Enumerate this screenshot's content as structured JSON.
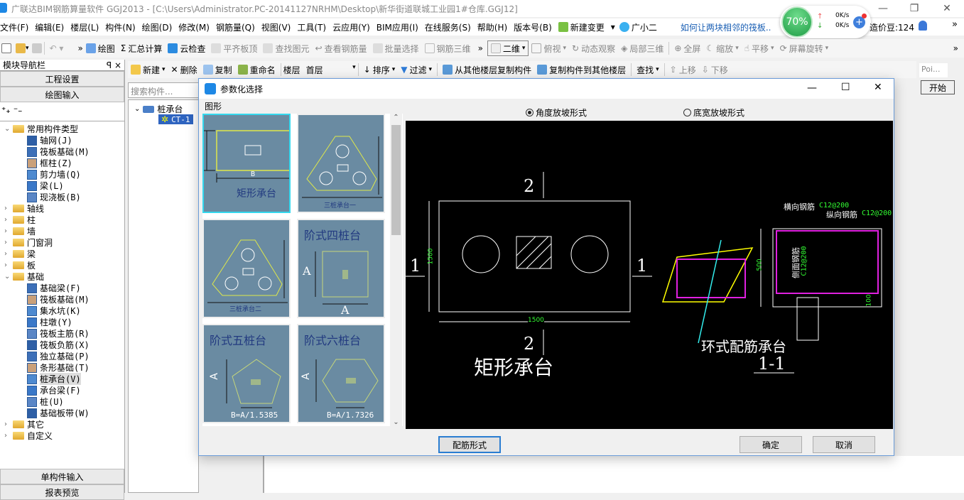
{
  "window": {
    "title": "广联达BIM钢筋算量软件 GGJ2013 - [C:\\Users\\Administrator.PC-20141127NRHM\\Desktop\\新华街道联城工业园1#仓库.GGJ12]",
    "minimize_icon": "minimize-icon",
    "maximize_icon": "restore-icon",
    "close_icon": "close-icon"
  },
  "menubar": {
    "items": [
      "文件(F)",
      "编辑(E)",
      "楼层(L)",
      "构件(N)",
      "绘图(D)",
      "修改(M)",
      "钢筋量(Q)",
      "视图(V)",
      "工具(T)",
      "云应用(Y)",
      "BIM应用(I)",
      "在线服务(S)",
      "帮助(H)",
      "版本号(B)",
      "新建变更",
      "广小二"
    ],
    "news": "如何让两块相邻的筏板..",
    "beans": "造价豆:124",
    "widget": {
      "percent": "70%",
      "up": "0K/s",
      "down": "0K/s"
    }
  },
  "toolbar1": {
    "items": [
      "绘图",
      "汇总计算",
      "云检查",
      "平齐板顶",
      "查找图元",
      "查看钢筋量",
      "批量选择",
      "钢筋三维",
      "二维",
      "俯视",
      "动态观察",
      "局部三维",
      "全屏",
      "缩放",
      "平移",
      "屏幕旋转"
    ]
  },
  "toolbar2": {
    "items": [
      "新建",
      "删除",
      "复制",
      "重命名",
      "楼层",
      "首层",
      "排序",
      "过滤",
      "从其他楼层复制构件",
      "复制构件到其他楼层",
      "查找",
      "上移",
      "下移"
    ]
  },
  "right_panel": {
    "poi": "Poi...",
    "start": "开始"
  },
  "nav": {
    "title": "模块导航栏",
    "pin": "ꟼ",
    "close": "×",
    "btn_settings": "工程设置",
    "btn_draw": "绘图输入",
    "btn_single": "单构件输入",
    "btn_report": "报表预览",
    "tree": [
      {
        "label": "常用构件类型",
        "level": 0,
        "type": "folder-open"
      },
      {
        "label": "轴网(J)",
        "level": 1
      },
      {
        "label": "筏板基础(M)",
        "level": 1
      },
      {
        "label": "框柱(Z)",
        "level": 1
      },
      {
        "label": "剪力墙(Q)",
        "level": 1
      },
      {
        "label": "梁(L)",
        "level": 1
      },
      {
        "label": "现浇板(B)",
        "level": 1
      },
      {
        "label": "轴线",
        "level": 0,
        "type": "folder"
      },
      {
        "label": "柱",
        "level": 0,
        "type": "folder"
      },
      {
        "label": "墙",
        "level": 0,
        "type": "folder"
      },
      {
        "label": "门窗洞",
        "level": 0,
        "type": "folder"
      },
      {
        "label": "梁",
        "level": 0,
        "type": "folder"
      },
      {
        "label": "板",
        "level": 0,
        "type": "folder"
      },
      {
        "label": "基础",
        "level": 0,
        "type": "folder-open"
      },
      {
        "label": "基础梁(F)",
        "level": 1
      },
      {
        "label": "筏板基础(M)",
        "level": 1
      },
      {
        "label": "集水坑(K)",
        "level": 1
      },
      {
        "label": "柱墩(Y)",
        "level": 1
      },
      {
        "label": "筏板主筋(R)",
        "level": 1
      },
      {
        "label": "筏板负筋(X)",
        "level": 1
      },
      {
        "label": "独立基础(P)",
        "level": 1
      },
      {
        "label": "条形基础(T)",
        "level": 1
      },
      {
        "label": "桩承台(V)",
        "level": 1,
        "selected": true
      },
      {
        "label": "承台梁(F)",
        "level": 1
      },
      {
        "label": "桩(U)",
        "level": 1
      },
      {
        "label": "基础板带(W)",
        "level": 1
      },
      {
        "label": "其它",
        "level": 0,
        "type": "folder"
      },
      {
        "label": "自定义",
        "level": 0,
        "type": "folder"
      }
    ]
  },
  "component_list": {
    "search_placeholder": "搜索构件...",
    "root": "桩承台",
    "child": "CT-1"
  },
  "dialog": {
    "title": "参数化选择",
    "group_label": "图形",
    "radio_angle": "角度放坡形式",
    "radio_width": "底宽放坡形式",
    "radio_selected": "角度放坡形式",
    "thumbs": [
      {
        "label": "矩形承台",
        "selected": true,
        "dim": "B"
      },
      {
        "label": "三桩承台一"
      },
      {
        "label": "三桩承台二"
      },
      {
        "label": "阶式四桩台",
        "dim": "A"
      },
      {
        "label": "阶式五桩台",
        "formula": "B=A/1.5385",
        "dim": "A"
      },
      {
        "label": "阶式六桩台",
        "formula": "B=A/1.7326",
        "dim": "A"
      }
    ],
    "preview": {
      "plan_title": "矩形承台",
      "section_mark_1": "1",
      "section_mark_2": "2",
      "width_dim": "1500",
      "height_dim": "1500",
      "section_title": "环式配筋承台",
      "section_label": "1-1",
      "transverse_label": "横向钢筋",
      "transverse_spec": "C12@200",
      "longitudinal_label": "纵向钢筋",
      "longitudinal_spec": "C12@200",
      "side_label": "侧面钢筋",
      "side_spec": "C12@200",
      "depth_dim": "500",
      "cover_dim": "100"
    },
    "btn_rebar": "配筋形式",
    "btn_ok": "确定",
    "btn_cancel": "取消"
  }
}
